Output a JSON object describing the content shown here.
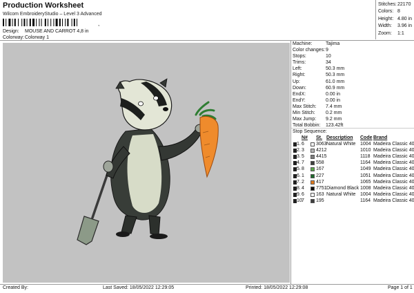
{
  "header": {
    "title": "Production Worksheet",
    "subtitle": "Wilcom EmbroideryStudio – Level 3 Advanced",
    "barcode_sep": ","
  },
  "design": {
    "label": "Design:",
    "value": "MOUSE AND CARROT 4,8 in"
  },
  "colorway": {
    "label": "Colorway:",
    "value": "Colorway 1"
  },
  "stats": [
    {
      "label": "Stitches:",
      "value": "22170"
    },
    {
      "label": "Colors:",
      "value": "8"
    },
    {
      "label": "Height:",
      "value": "4.80 in"
    },
    {
      "label": "Width:",
      "value": "3.96 in"
    },
    {
      "label": "Zoom:",
      "value": "1:1"
    }
  ],
  "machine_info": [
    {
      "label": "Machine:",
      "value": "Tajima"
    },
    {
      "label": "Color changes:",
      "value": "9"
    },
    {
      "label": "Stops:",
      "value": "10"
    },
    {
      "label": "Trims:",
      "value": "34"
    },
    {
      "label": "Left:",
      "value": "50.3 mm"
    },
    {
      "label": "Right:",
      "value": "50.3 mm"
    },
    {
      "label": "Up:",
      "value": "61.0 mm"
    },
    {
      "label": "Down:",
      "value": "60.9 mm"
    },
    {
      "label": "EndX:",
      "value": "0.00 in"
    },
    {
      "label": "EndY:",
      "value": "0.00 in"
    },
    {
      "label": "Max Stitch:",
      "value": "7.4 mm"
    },
    {
      "label": "Min Stitch:",
      "value": "0.2 mm"
    },
    {
      "label": "Max Jump:",
      "value": "9.2 mm"
    },
    {
      "label": "Total Bobbin:",
      "value": "123.42ft"
    }
  ],
  "stop_sequence": {
    "title": "Stop Sequence:",
    "headers": {
      "n": "N#",
      "st": "St.",
      "desc": "Description",
      "code": "Code",
      "brand": "Brand"
    },
    "rows": [
      {
        "stop": "1.",
        "n": "6",
        "color": "#f4f4f4",
        "st": "3063",
        "desc": "Natural White",
        "code": "1004",
        "brand": "Madeira Classic 40"
      },
      {
        "stop": "2.",
        "n": "3",
        "color": "#b4b4b4",
        "st": "4212",
        "desc": "",
        "code": "1010",
        "brand": "Madeira Classic 40"
      },
      {
        "stop": "3.",
        "n": "5",
        "color": "#7e7e7e",
        "st": "4415",
        "desc": "",
        "code": "1118",
        "brand": "Madeira Classic 40"
      },
      {
        "stop": "4.",
        "n": "7",
        "color": "#3e3e3e",
        "st": "558",
        "desc": "",
        "code": "1164",
        "brand": "Madeira Classic 40"
      },
      {
        "stop": "5.",
        "n": "8",
        "color": "#5aa84a",
        "st": "167",
        "desc": "",
        "code": "1049",
        "brand": "Madeira Classic 40"
      },
      {
        "stop": "6.",
        "n": "1",
        "color": "#1f6b2d",
        "st": "227",
        "desc": "",
        "code": "1051",
        "brand": "Madeira Classic 40"
      },
      {
        "stop": "7.",
        "n": "2",
        "color": "#e07a1f",
        "st": "417",
        "desc": "",
        "code": "1065",
        "brand": "Madeira Classic 40"
      },
      {
        "stop": "8.",
        "n": "4",
        "color": "#101010",
        "st": "7751",
        "desc": "Diamond Black",
        "code": "1008",
        "brand": "Madeira Classic 40"
      },
      {
        "stop": "9.",
        "n": "6",
        "color": "#f4f4f4",
        "st": "163",
        "desc": "Natural White",
        "code": "1004",
        "brand": "Madeira Classic 40"
      },
      {
        "stop": "10.",
        "n": "7",
        "color": "#3e3e3e",
        "st": "195",
        "desc": "",
        "code": "1164",
        "brand": "Madeira Classic 40"
      }
    ]
  },
  "footer": {
    "created_by": "Created By:",
    "last_saved": "Last Saved: 18/05/2022 12:29:05",
    "printed": "Printed: 18/05/2022 12:29:08",
    "page": "Page 1 of 1"
  },
  "colors": {
    "canvas_bg": "#c2c2c2",
    "divider": "#999999"
  }
}
